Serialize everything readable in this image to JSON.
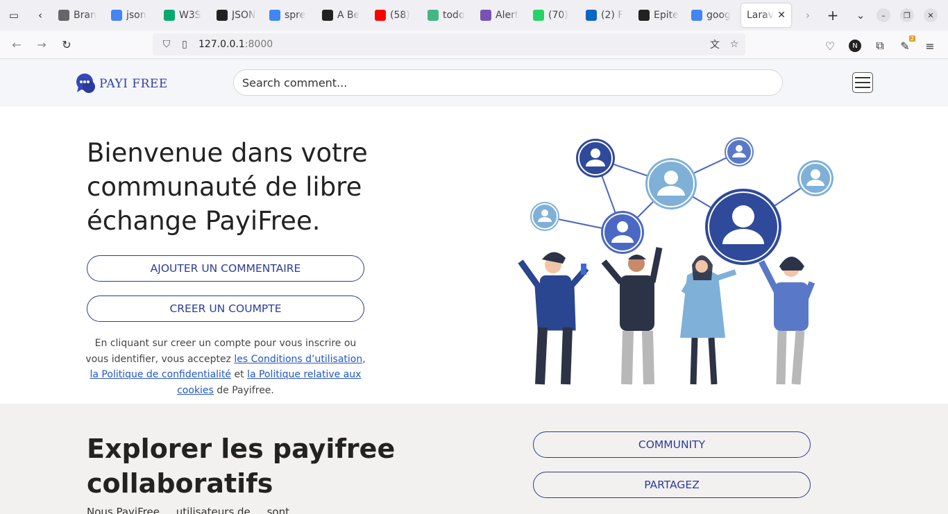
{
  "browser": {
    "tabs": [
      {
        "title": "Bran",
        "favicon": "folder-icon",
        "color": "#666"
      },
      {
        "title": "json",
        "favicon": "google-icon",
        "color": "#4285f4"
      },
      {
        "title": "W3S",
        "favicon": "w3schools-icon",
        "color": "#04aa6d"
      },
      {
        "title": "JSON",
        "favicon": "json-icon",
        "color": "#222"
      },
      {
        "title": "spre",
        "favicon": "google-icon",
        "color": "#4285f4"
      },
      {
        "title": "A Be",
        "favicon": "app-icon",
        "color": "#222"
      },
      {
        "title": "(58)",
        "favicon": "youtube-icon",
        "color": "#ff0000"
      },
      {
        "title": "todo",
        "favicon": "vue-icon",
        "color": "#41b883"
      },
      {
        "title": "Alert",
        "favicon": "bootstrap-icon",
        "color": "#7952b3"
      },
      {
        "title": "(70)",
        "favicon": "whatsapp-icon",
        "color": "#25d366"
      },
      {
        "title": "(2) F",
        "favicon": "linkedin-icon",
        "color": "#0a66c2"
      },
      {
        "title": "Epite",
        "favicon": "github-icon",
        "color": "#222"
      },
      {
        "title": "goog",
        "favicon": "google-icon",
        "color": "#4285f4"
      }
    ],
    "active_tab": {
      "title": "Larave"
    },
    "url": {
      "host": "127.0.0.1",
      "port": ":8000"
    },
    "ext_badge": "2"
  },
  "header": {
    "logo_text": "PAYI FREE",
    "search_placeholder": "Search comment..."
  },
  "hero": {
    "title": "Bienvenue dans votre communauté de libre échange PayiFree.",
    "btn_add_comment": "AJOUTER UN COMMENTAIRE",
    "btn_create_account": "CREER UN COUMPTE",
    "terms": {
      "pre": "En cliquant sur creer un compte pour vous inscrire ou vous identifier, vous acceptez ",
      "link1": "les Conditions d’utilisation",
      "sep1": ", ",
      "link2": "la Politique de confidentialité",
      "sep2": " et ",
      "link3": "la Politique relative aux cookies",
      "post": " de Payifree."
    }
  },
  "explore": {
    "title": "Explorer les payifree collaboratifs",
    "btn_community": "COMMUNITY",
    "btn_partagez": "PARTAGEZ",
    "subtitle": "Nous PayiFree ... utilisateurs de ... sont"
  },
  "colors": {
    "brand": "#2e3fa8",
    "button_border": "#2c3c8a",
    "link": "#2156c8",
    "explore_bg": "#f2f1ef"
  }
}
